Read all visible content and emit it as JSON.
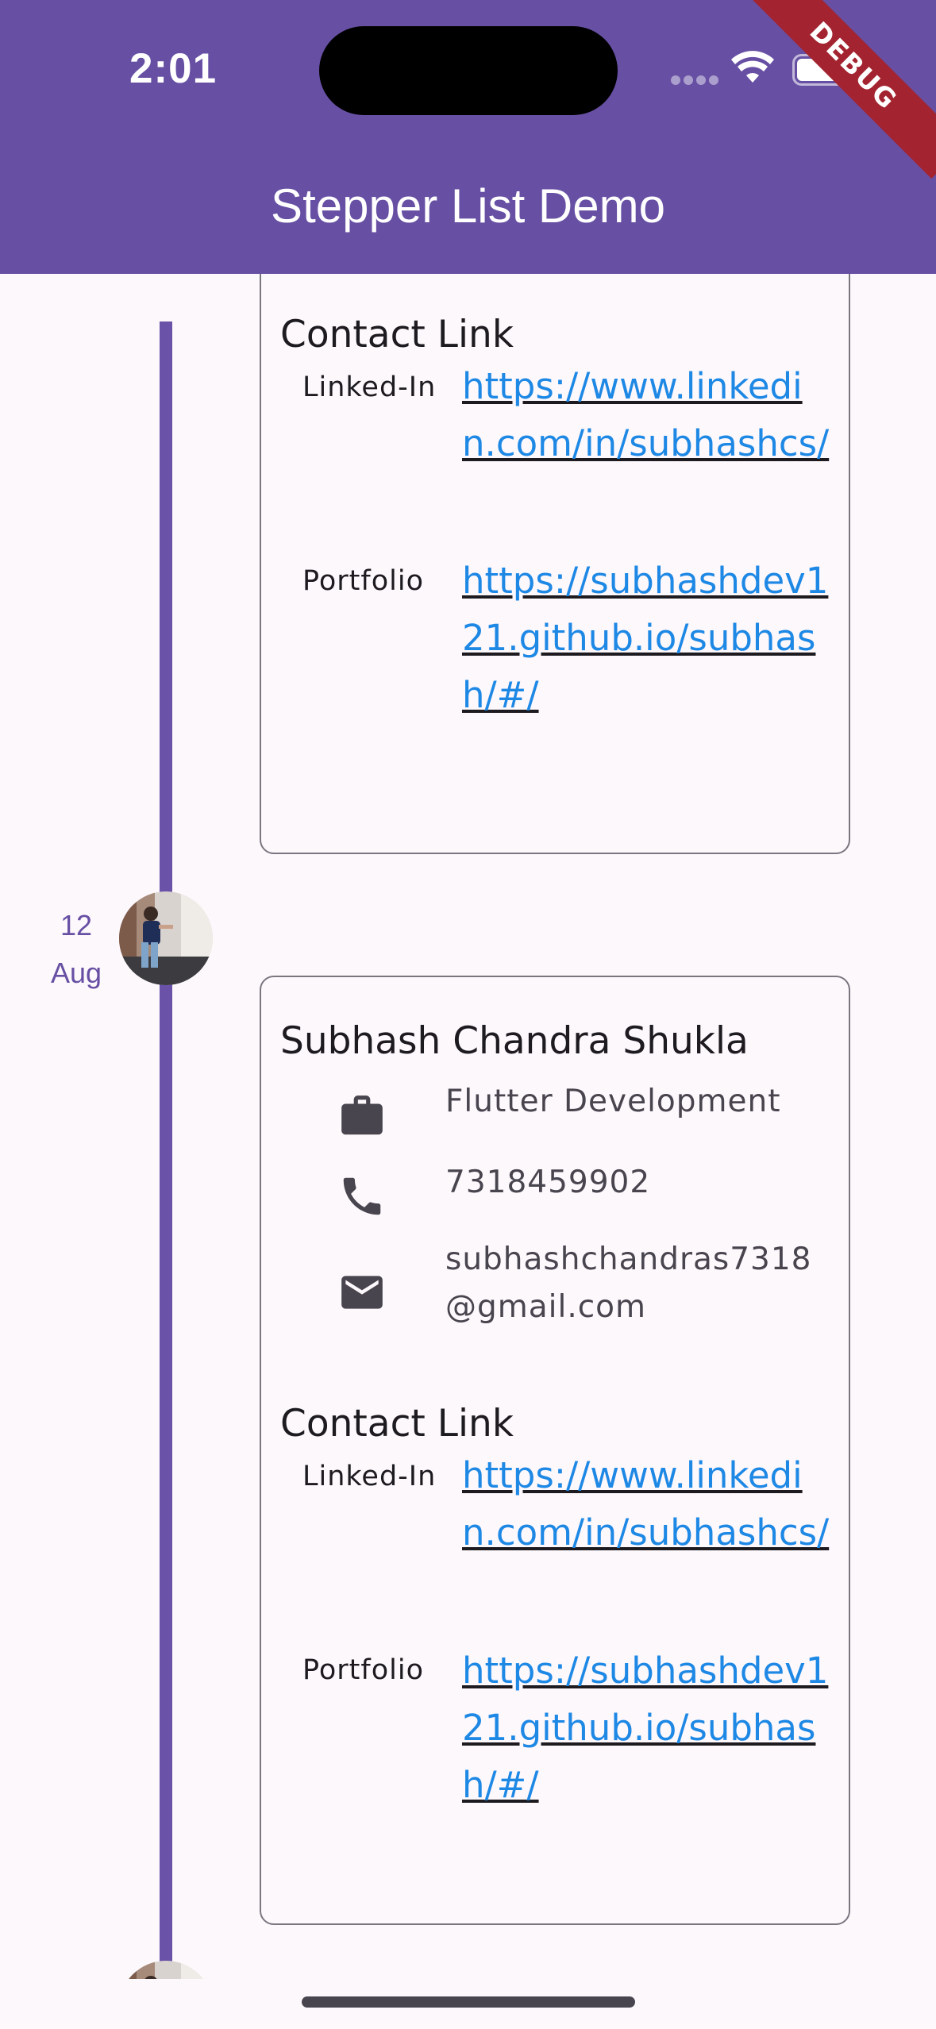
{
  "status_bar": {
    "time": "2:01"
  },
  "app_bar": {
    "title": "Stepper List Demo",
    "debug_banner": "DEBUG"
  },
  "steps": [
    {
      "date_day": "12",
      "date_month": "Aug",
      "name": "Subhash Chandra Shukla",
      "role": "Flutter Development",
      "phone": "7318459902",
      "email": "subhashchandras7318@gmail.com",
      "contact_title": "Contact Link",
      "links": [
        {
          "label": "Linked-In",
          "url": "https://www.linkedin.com/in/subhashcs/"
        },
        {
          "label": "Portfolio",
          "url": "https://subhashdev121.github.io/subhash/#/"
        }
      ]
    }
  ],
  "prev_card": {
    "contact_title": "Contact Link",
    "links": [
      {
        "label": "Linked-In",
        "url": "https://www.linkedin.com/in/subhashcs/"
      },
      {
        "label": "Portfolio",
        "url": "https://subhashdev121.github.io/subhash/#/"
      }
    ]
  },
  "colors": {
    "primary": "#6750a4",
    "link": "#1e88e5",
    "timeline": "#6a52a8",
    "debug_banner": "#a32430"
  },
  "icons": [
    "briefcase-icon",
    "phone-icon",
    "email-icon",
    "wifi-icon",
    "battery-icon",
    "avatar"
  ]
}
